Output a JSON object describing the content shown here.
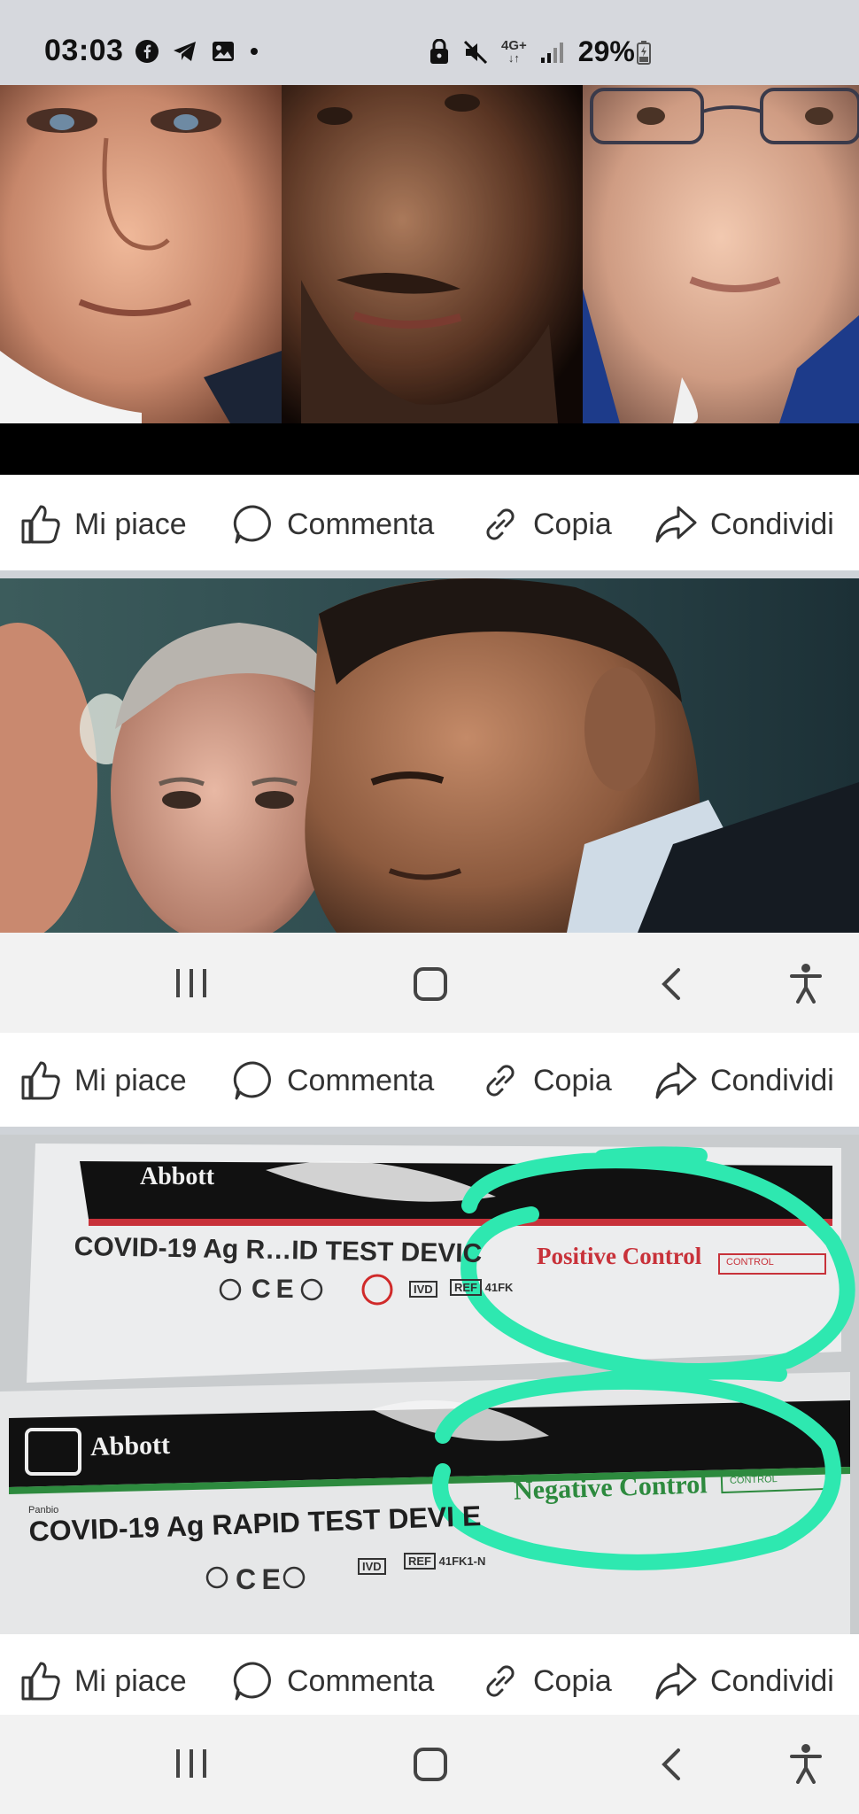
{
  "status_bar": {
    "time": "03:03",
    "network": "4G+",
    "battery": "29%",
    "left_icons": [
      "facebook-icon",
      "telegram-icon",
      "gallery-icon",
      "dot-icon"
    ],
    "right_icons": [
      "lock-icon",
      "mute-icon",
      "network-icon",
      "signal-icon",
      "battery-icon"
    ]
  },
  "posts": [
    {
      "image_desc": "faces-closeup",
      "actions": {
        "like": "Mi piace",
        "comment": "Commenta",
        "copy": "Copia",
        "share": "Condividi"
      }
    },
    {
      "image_desc": "two-men-portrait",
      "actions": {
        "like": "Mi piace",
        "comment": "Commenta",
        "copy": "Copia",
        "share": "Condividi"
      }
    },
    {
      "image_desc": "rapid-test-devices",
      "test_image": {
        "top_brand": "Abbott",
        "top_product": "COVID-19 Ag R…ID TEST DEVIC",
        "top_control": "Positive Control",
        "bottom_brand": "Abbott",
        "bottom_prefix": "Panbio",
        "bottom_product": "COVID-19 Ag RAPID TEST DEVI E",
        "bottom_control": "Negative Control",
        "control_tag": "CONTROL",
        "ivd": "IVD",
        "ref": "REF",
        "ref_code_top": "41FK",
        "ref_code_bottom": "41FK1-N",
        "highlight_color": "#2ee8b0"
      }
    }
  ],
  "nav": {
    "recents": "recents-icon",
    "home": "home-icon",
    "back": "back-icon",
    "accessibility": "accessibility-icon"
  },
  "colors": {
    "status_bar_bg": "#d6d8dd",
    "separator": "#cfd3d8",
    "nav_bg": "#f2f2f2",
    "highlight": "#2ee8b0"
  }
}
